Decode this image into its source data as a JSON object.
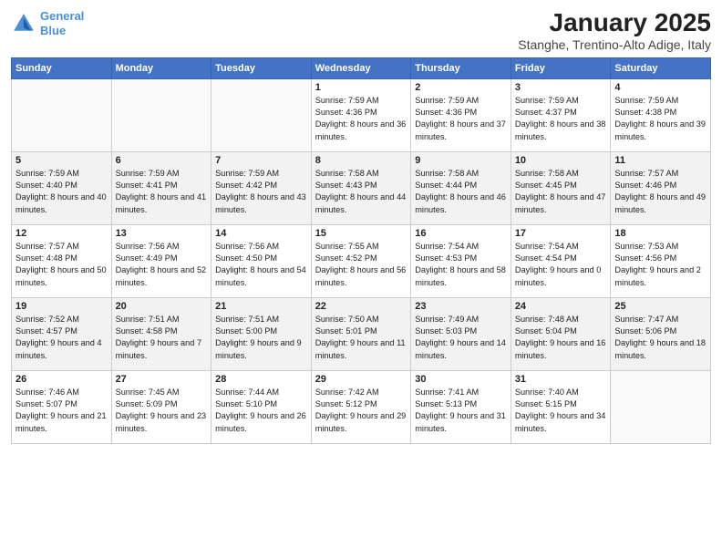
{
  "logo": {
    "line1": "General",
    "line2": "Blue"
  },
  "title": "January 2025",
  "subtitle": "Stanghe, Trentino-Alto Adige, Italy",
  "days_header": [
    "Sunday",
    "Monday",
    "Tuesday",
    "Wednesday",
    "Thursday",
    "Friday",
    "Saturday"
  ],
  "weeks": [
    [
      {
        "day": "",
        "info": ""
      },
      {
        "day": "",
        "info": ""
      },
      {
        "day": "",
        "info": ""
      },
      {
        "day": "1",
        "info": "Sunrise: 7:59 AM\nSunset: 4:36 PM\nDaylight: 8 hours and 36 minutes."
      },
      {
        "day": "2",
        "info": "Sunrise: 7:59 AM\nSunset: 4:36 PM\nDaylight: 8 hours and 37 minutes."
      },
      {
        "day": "3",
        "info": "Sunrise: 7:59 AM\nSunset: 4:37 PM\nDaylight: 8 hours and 38 minutes."
      },
      {
        "day": "4",
        "info": "Sunrise: 7:59 AM\nSunset: 4:38 PM\nDaylight: 8 hours and 39 minutes."
      }
    ],
    [
      {
        "day": "5",
        "info": "Sunrise: 7:59 AM\nSunset: 4:40 PM\nDaylight: 8 hours and 40 minutes."
      },
      {
        "day": "6",
        "info": "Sunrise: 7:59 AM\nSunset: 4:41 PM\nDaylight: 8 hours and 41 minutes."
      },
      {
        "day": "7",
        "info": "Sunrise: 7:59 AM\nSunset: 4:42 PM\nDaylight: 8 hours and 43 minutes."
      },
      {
        "day": "8",
        "info": "Sunrise: 7:58 AM\nSunset: 4:43 PM\nDaylight: 8 hours and 44 minutes."
      },
      {
        "day": "9",
        "info": "Sunrise: 7:58 AM\nSunset: 4:44 PM\nDaylight: 8 hours and 46 minutes."
      },
      {
        "day": "10",
        "info": "Sunrise: 7:58 AM\nSunset: 4:45 PM\nDaylight: 8 hours and 47 minutes."
      },
      {
        "day": "11",
        "info": "Sunrise: 7:57 AM\nSunset: 4:46 PM\nDaylight: 8 hours and 49 minutes."
      }
    ],
    [
      {
        "day": "12",
        "info": "Sunrise: 7:57 AM\nSunset: 4:48 PM\nDaylight: 8 hours and 50 minutes."
      },
      {
        "day": "13",
        "info": "Sunrise: 7:56 AM\nSunset: 4:49 PM\nDaylight: 8 hours and 52 minutes."
      },
      {
        "day": "14",
        "info": "Sunrise: 7:56 AM\nSunset: 4:50 PM\nDaylight: 8 hours and 54 minutes."
      },
      {
        "day": "15",
        "info": "Sunrise: 7:55 AM\nSunset: 4:52 PM\nDaylight: 8 hours and 56 minutes."
      },
      {
        "day": "16",
        "info": "Sunrise: 7:54 AM\nSunset: 4:53 PM\nDaylight: 8 hours and 58 minutes."
      },
      {
        "day": "17",
        "info": "Sunrise: 7:54 AM\nSunset: 4:54 PM\nDaylight: 9 hours and 0 minutes."
      },
      {
        "day": "18",
        "info": "Sunrise: 7:53 AM\nSunset: 4:56 PM\nDaylight: 9 hours and 2 minutes."
      }
    ],
    [
      {
        "day": "19",
        "info": "Sunrise: 7:52 AM\nSunset: 4:57 PM\nDaylight: 9 hours and 4 minutes."
      },
      {
        "day": "20",
        "info": "Sunrise: 7:51 AM\nSunset: 4:58 PM\nDaylight: 9 hours and 7 minutes."
      },
      {
        "day": "21",
        "info": "Sunrise: 7:51 AM\nSunset: 5:00 PM\nDaylight: 9 hours and 9 minutes."
      },
      {
        "day": "22",
        "info": "Sunrise: 7:50 AM\nSunset: 5:01 PM\nDaylight: 9 hours and 11 minutes."
      },
      {
        "day": "23",
        "info": "Sunrise: 7:49 AM\nSunset: 5:03 PM\nDaylight: 9 hours and 14 minutes."
      },
      {
        "day": "24",
        "info": "Sunrise: 7:48 AM\nSunset: 5:04 PM\nDaylight: 9 hours and 16 minutes."
      },
      {
        "day": "25",
        "info": "Sunrise: 7:47 AM\nSunset: 5:06 PM\nDaylight: 9 hours and 18 minutes."
      }
    ],
    [
      {
        "day": "26",
        "info": "Sunrise: 7:46 AM\nSunset: 5:07 PM\nDaylight: 9 hours and 21 minutes."
      },
      {
        "day": "27",
        "info": "Sunrise: 7:45 AM\nSunset: 5:09 PM\nDaylight: 9 hours and 23 minutes."
      },
      {
        "day": "28",
        "info": "Sunrise: 7:44 AM\nSunset: 5:10 PM\nDaylight: 9 hours and 26 minutes."
      },
      {
        "day": "29",
        "info": "Sunrise: 7:42 AM\nSunset: 5:12 PM\nDaylight: 9 hours and 29 minutes."
      },
      {
        "day": "30",
        "info": "Sunrise: 7:41 AM\nSunset: 5:13 PM\nDaylight: 9 hours and 31 minutes."
      },
      {
        "day": "31",
        "info": "Sunrise: 7:40 AM\nSunset: 5:15 PM\nDaylight: 9 hours and 34 minutes."
      },
      {
        "day": "",
        "info": ""
      }
    ]
  ]
}
